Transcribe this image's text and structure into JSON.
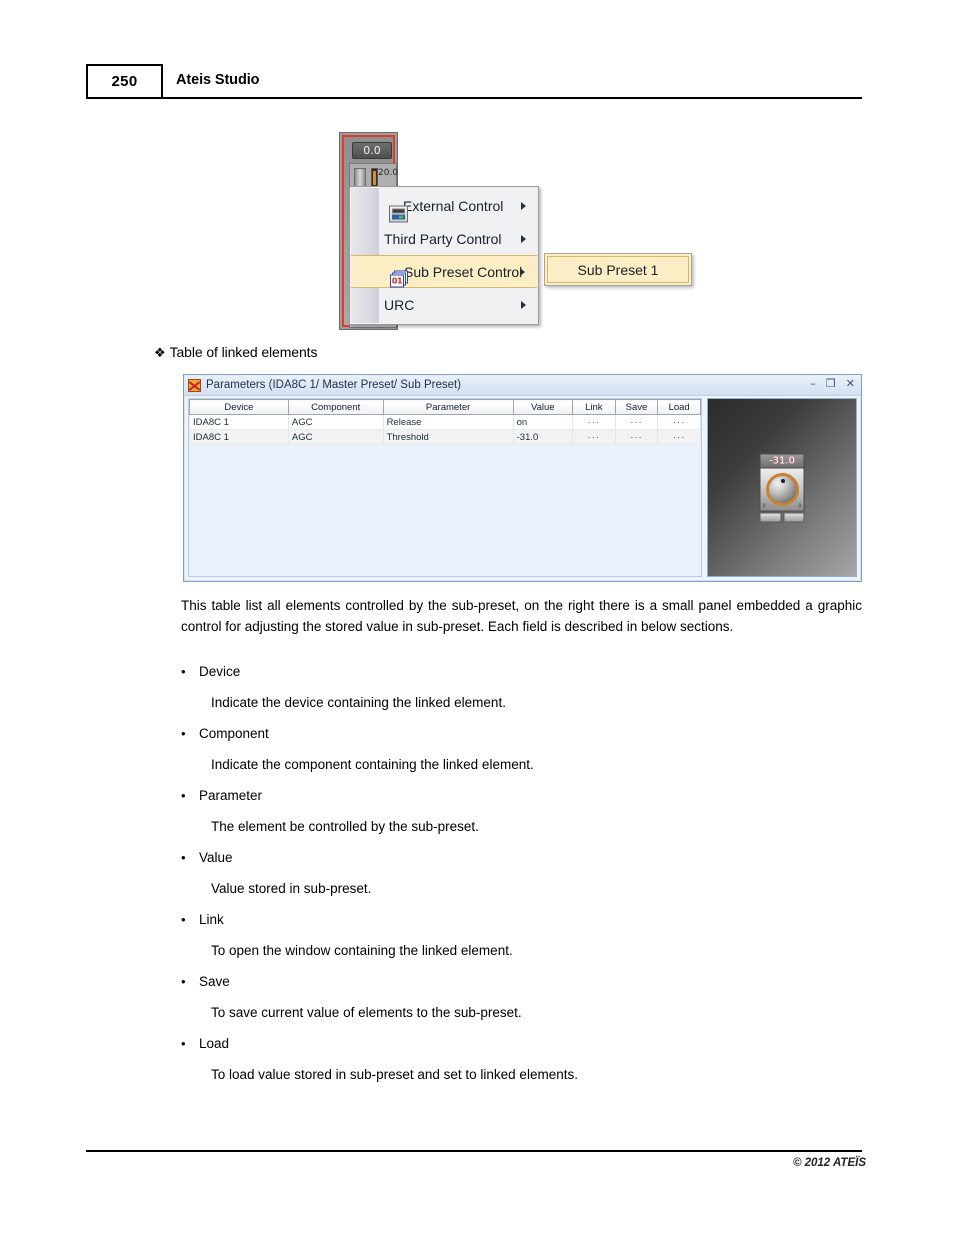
{
  "page": {
    "number": "250",
    "header_title": "Ateis Studio",
    "footer_copyright": "© 2012 ATEÏS"
  },
  "figure_menu": {
    "fader": {
      "readout": "0.0",
      "scale_label": "20.0"
    },
    "context_menu": {
      "items": [
        {
          "label": "External Control",
          "icon": "rack-icon",
          "has_submenu": true,
          "selected": false
        },
        {
          "label": "Third Party Control",
          "icon": "",
          "has_submenu": true,
          "selected": false
        },
        {
          "label": "Sub Preset Control",
          "icon": "preset-icon",
          "has_submenu": true,
          "selected": true
        },
        {
          "label": "URC",
          "icon": "",
          "has_submenu": true,
          "selected": false
        }
      ],
      "preset_icon_number": "01"
    },
    "submenu": {
      "items": [
        {
          "label": "Sub Preset 1"
        }
      ]
    }
  },
  "section_heading": {
    "glyph": "❖",
    "text": "Table of linked elements"
  },
  "parameters_window": {
    "title": "Parameters (IDA8C 1/ Master Preset/ Sub Preset)",
    "window_buttons": {
      "minimize": "–",
      "maximize": "❐",
      "close": "✕"
    },
    "table": {
      "columns": [
        "Device",
        "Component",
        "Parameter",
        "Value",
        "Link",
        "Save",
        "Load"
      ],
      "rows": [
        {
          "device": "IDA8C 1",
          "component": "AGC",
          "parameter": "Release",
          "value": "on",
          "link": "···",
          "save": "···",
          "load": "···"
        },
        {
          "device": "IDA8C 1",
          "component": "AGC",
          "parameter": "Threshold",
          "value": "-31.0",
          "link": "···",
          "save": "···",
          "load": "···"
        }
      ]
    },
    "preview_panel": {
      "knob_readout": "-31.0",
      "knob_end_left": "0",
      "knob_end_right": "0"
    }
  },
  "body": {
    "paragraph": "This table list all elements controlled by the sub-preset, on the right there is a small panel embedded a graphic control for adjusting the stored value in sub-preset. Each field is described in below sections.",
    "terms": [
      {
        "bullet": "•",
        "label": "Device",
        "description": "Indicate the device containing the linked element."
      },
      {
        "bullet": "•",
        "label": "Component",
        "description": "Indicate the component containing the linked element."
      },
      {
        "bullet": "•",
        "label": "Parameter",
        "description": "The element be controlled by the sub-preset."
      },
      {
        "bullet": "•",
        "label": "Value",
        "description": "Value stored in sub-preset."
      },
      {
        "bullet": "•",
        "label": "Link",
        "description": "To open the window containing the linked element."
      },
      {
        "bullet": "•",
        "label": "Save",
        "description": "To save current value of elements to the sub-preset."
      },
      {
        "bullet": "•",
        "label": "Load",
        "description": "To load value stored in sub-preset and set to linked elements."
      }
    ]
  },
  "colors": {
    "menu_highlight": "#fbeec4",
    "menu_highlight_border": "#d6b86b",
    "window_border": "#7e9fc4",
    "fader_accent": "#e33b2a",
    "knob_ring": "#c8812e"
  }
}
